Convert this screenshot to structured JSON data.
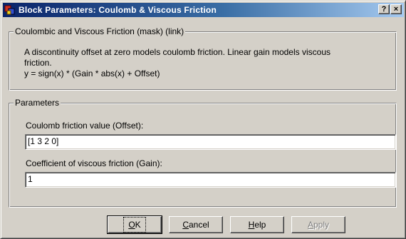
{
  "window": {
    "title": "Block Parameters: Coulomb & Viscous Friction",
    "help_button": "?",
    "close_button": "×"
  },
  "description_group": {
    "legend": "Coulombic and Viscous Friction (mask) (link)",
    "line1": "A discontinuity offset at zero models coulomb friction.  Linear gain models viscous",
    "line2": "friction.",
    "line3": "y = sign(x) * (Gain * abs(x) + Offset)"
  },
  "parameters_group": {
    "legend": "Parameters",
    "offset_label": "Coulomb friction value (Offset):",
    "offset_value": "[1 3 2 0]",
    "gain_label": "Coefficient of viscous friction (Gain):",
    "gain_value": "1"
  },
  "buttons": {
    "ok": {
      "mnemonic": "O",
      "rest": "K"
    },
    "cancel": {
      "mnemonic": "C",
      "rest": "ancel"
    },
    "help": {
      "mnemonic": "H",
      "rest": "elp"
    },
    "apply": {
      "mnemonic": "A",
      "rest": "pply",
      "enabled": false
    }
  }
}
